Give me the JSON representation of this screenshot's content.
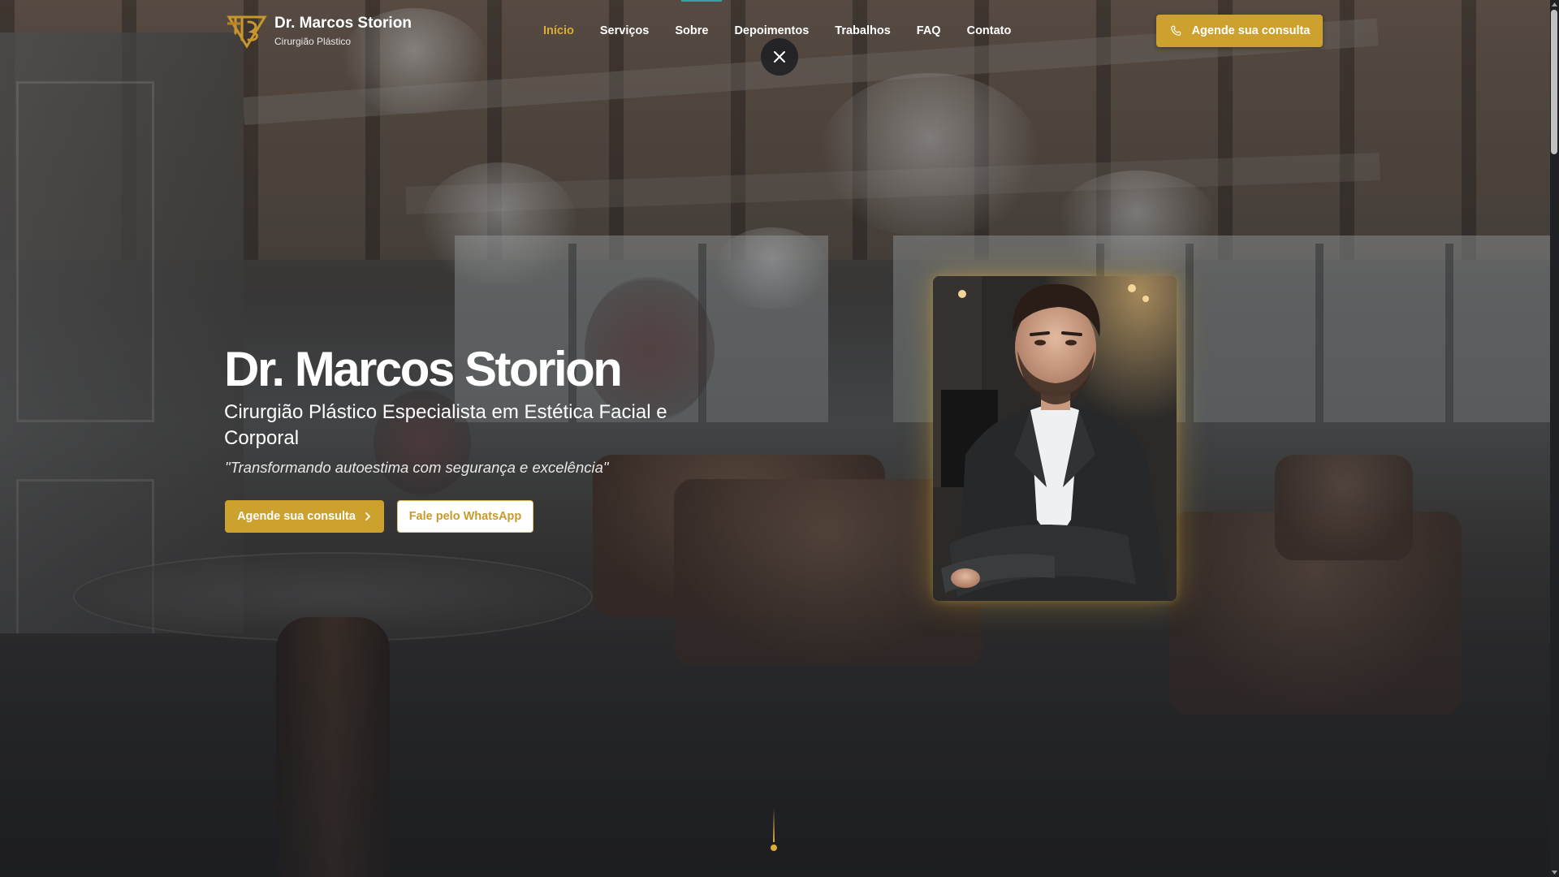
{
  "header": {
    "logo_name": "Dr. Marcos Storion",
    "logo_subtitle": "Cirurgião Plástico",
    "cta_label": "Agende sua consulta",
    "cta_icon": "phone-icon",
    "close_icon": "close-icon"
  },
  "nav": {
    "items": [
      {
        "label": "Início",
        "active": true
      },
      {
        "label": "Serviços",
        "active": false
      },
      {
        "label": "Sobre",
        "active": false
      },
      {
        "label": "Depoimentos",
        "active": false
      },
      {
        "label": "Trabalhos",
        "active": false
      },
      {
        "label": "FAQ",
        "active": false
      },
      {
        "label": "Contato",
        "active": false
      }
    ]
  },
  "hero": {
    "title": "Dr. Marcos Storion",
    "subtitle": "Cirurgião Plástico Especialista em Estética Facial e Corporal",
    "quote": "\"Transformando autoestima com segurança e excelência\"",
    "primary_button": "Agende sua consulta",
    "primary_button_icon": "chevron-right-icon",
    "secondary_button": "Fale pelo WhatsApp"
  },
  "colors": {
    "accent_gold": "#cda12d",
    "nav_active": "#d9ad36",
    "text_white": "#ffffff"
  }
}
